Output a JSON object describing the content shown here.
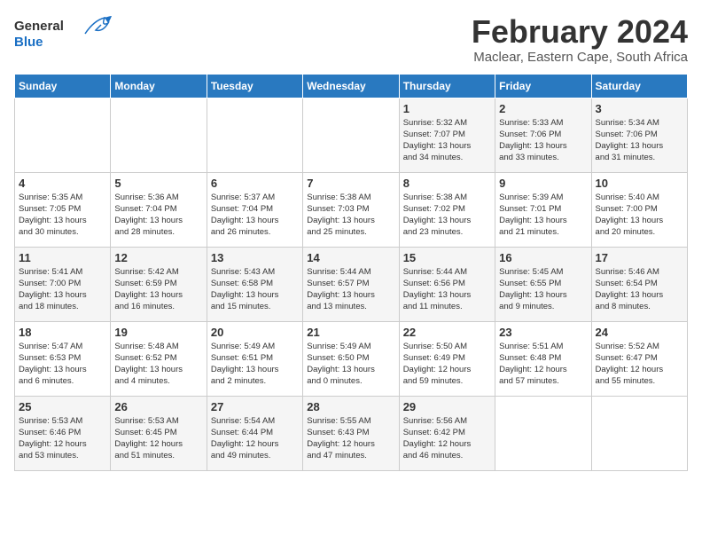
{
  "header": {
    "logo_general": "General",
    "logo_blue": "Blue",
    "month": "February 2024",
    "location": "Maclear, Eastern Cape, South Africa"
  },
  "days_of_week": [
    "Sunday",
    "Monday",
    "Tuesday",
    "Wednesday",
    "Thursday",
    "Friday",
    "Saturday"
  ],
  "weeks": [
    [
      {
        "day": "",
        "info": ""
      },
      {
        "day": "",
        "info": ""
      },
      {
        "day": "",
        "info": ""
      },
      {
        "day": "",
        "info": ""
      },
      {
        "day": "1",
        "info": "Sunrise: 5:32 AM\nSunset: 7:07 PM\nDaylight: 13 hours\nand 34 minutes."
      },
      {
        "day": "2",
        "info": "Sunrise: 5:33 AM\nSunset: 7:06 PM\nDaylight: 13 hours\nand 33 minutes."
      },
      {
        "day": "3",
        "info": "Sunrise: 5:34 AM\nSunset: 7:06 PM\nDaylight: 13 hours\nand 31 minutes."
      }
    ],
    [
      {
        "day": "4",
        "info": "Sunrise: 5:35 AM\nSunset: 7:05 PM\nDaylight: 13 hours\nand 30 minutes."
      },
      {
        "day": "5",
        "info": "Sunrise: 5:36 AM\nSunset: 7:04 PM\nDaylight: 13 hours\nand 28 minutes."
      },
      {
        "day": "6",
        "info": "Sunrise: 5:37 AM\nSunset: 7:04 PM\nDaylight: 13 hours\nand 26 minutes."
      },
      {
        "day": "7",
        "info": "Sunrise: 5:38 AM\nSunset: 7:03 PM\nDaylight: 13 hours\nand 25 minutes."
      },
      {
        "day": "8",
        "info": "Sunrise: 5:38 AM\nSunset: 7:02 PM\nDaylight: 13 hours\nand 23 minutes."
      },
      {
        "day": "9",
        "info": "Sunrise: 5:39 AM\nSunset: 7:01 PM\nDaylight: 13 hours\nand 21 minutes."
      },
      {
        "day": "10",
        "info": "Sunrise: 5:40 AM\nSunset: 7:00 PM\nDaylight: 13 hours\nand 20 minutes."
      }
    ],
    [
      {
        "day": "11",
        "info": "Sunrise: 5:41 AM\nSunset: 7:00 PM\nDaylight: 13 hours\nand 18 minutes."
      },
      {
        "day": "12",
        "info": "Sunrise: 5:42 AM\nSunset: 6:59 PM\nDaylight: 13 hours\nand 16 minutes."
      },
      {
        "day": "13",
        "info": "Sunrise: 5:43 AM\nSunset: 6:58 PM\nDaylight: 13 hours\nand 15 minutes."
      },
      {
        "day": "14",
        "info": "Sunrise: 5:44 AM\nSunset: 6:57 PM\nDaylight: 13 hours\nand 13 minutes."
      },
      {
        "day": "15",
        "info": "Sunrise: 5:44 AM\nSunset: 6:56 PM\nDaylight: 13 hours\nand 11 minutes."
      },
      {
        "day": "16",
        "info": "Sunrise: 5:45 AM\nSunset: 6:55 PM\nDaylight: 13 hours\nand 9 minutes."
      },
      {
        "day": "17",
        "info": "Sunrise: 5:46 AM\nSunset: 6:54 PM\nDaylight: 13 hours\nand 8 minutes."
      }
    ],
    [
      {
        "day": "18",
        "info": "Sunrise: 5:47 AM\nSunset: 6:53 PM\nDaylight: 13 hours\nand 6 minutes."
      },
      {
        "day": "19",
        "info": "Sunrise: 5:48 AM\nSunset: 6:52 PM\nDaylight: 13 hours\nand 4 minutes."
      },
      {
        "day": "20",
        "info": "Sunrise: 5:49 AM\nSunset: 6:51 PM\nDaylight: 13 hours\nand 2 minutes."
      },
      {
        "day": "21",
        "info": "Sunrise: 5:49 AM\nSunset: 6:50 PM\nDaylight: 13 hours\nand 0 minutes."
      },
      {
        "day": "22",
        "info": "Sunrise: 5:50 AM\nSunset: 6:49 PM\nDaylight: 12 hours\nand 59 minutes."
      },
      {
        "day": "23",
        "info": "Sunrise: 5:51 AM\nSunset: 6:48 PM\nDaylight: 12 hours\nand 57 minutes."
      },
      {
        "day": "24",
        "info": "Sunrise: 5:52 AM\nSunset: 6:47 PM\nDaylight: 12 hours\nand 55 minutes."
      }
    ],
    [
      {
        "day": "25",
        "info": "Sunrise: 5:53 AM\nSunset: 6:46 PM\nDaylight: 12 hours\nand 53 minutes."
      },
      {
        "day": "26",
        "info": "Sunrise: 5:53 AM\nSunset: 6:45 PM\nDaylight: 12 hours\nand 51 minutes."
      },
      {
        "day": "27",
        "info": "Sunrise: 5:54 AM\nSunset: 6:44 PM\nDaylight: 12 hours\nand 49 minutes."
      },
      {
        "day": "28",
        "info": "Sunrise: 5:55 AM\nSunset: 6:43 PM\nDaylight: 12 hours\nand 47 minutes."
      },
      {
        "day": "29",
        "info": "Sunrise: 5:56 AM\nSunset: 6:42 PM\nDaylight: 12 hours\nand 46 minutes."
      },
      {
        "day": "",
        "info": ""
      },
      {
        "day": "",
        "info": ""
      }
    ]
  ]
}
